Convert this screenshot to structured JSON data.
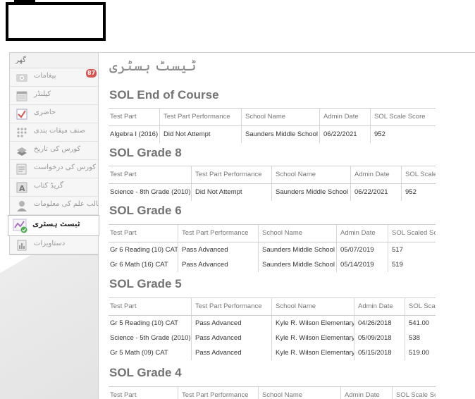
{
  "sidebar": {
    "home_label": "گھر",
    "items": [
      {
        "label": "پیغامات",
        "icon": "messages-icon",
        "badge": "87"
      },
      {
        "label": "کیلنڈر",
        "icon": "calendar-icon"
      },
      {
        "label": "حاضری",
        "icon": "attendance-icon"
      },
      {
        "label": "صنف میقات بندی",
        "icon": "class-schedule-icon"
      },
      {
        "label": "کورس کی تاریخ",
        "icon": "course-history-icon"
      },
      {
        "label": "کورس کی درخواست",
        "icon": "course-request-icon"
      },
      {
        "label": "گریڈ کتاب",
        "icon": "gradebook-icon"
      },
      {
        "label": "طالب علم کی معلومات",
        "icon": "student-info-icon"
      },
      {
        "label": "ٹیسٹ ہسٹری",
        "icon": "test-history-icon",
        "active": true
      },
      {
        "label": "دستاویزات",
        "icon": "documents-icon"
      }
    ]
  },
  "page_title": "ٹیسٹ ہسٹری",
  "sections": [
    {
      "title": "SOL End of Course",
      "headers": [
        "Test Part",
        "Test Part Performance",
        "School Name",
        "Admin Date",
        "SOL Scale Score"
      ],
      "rows": [
        [
          "Algebra I (2016)",
          "Did Not Attempt",
          "Saunders Middle School",
          "06/22/2021",
          "952"
        ]
      ]
    },
    {
      "title": "SOL Grade 8",
      "headers": [
        "Test Part",
        "Test Part Performance",
        "School Name",
        "Admin Date",
        "SOL Scale"
      ],
      "rows": [
        [
          "Science - 8th Grade (2010)",
          "Did Not Attempt",
          "Saunders Middle School",
          "06/22/2021",
          "952"
        ]
      ]
    },
    {
      "title": "SOL Grade 6",
      "headers": [
        "Test Part",
        "Test Part Performance",
        "School Name",
        "Admin Date",
        "SOL Scaled Sc"
      ],
      "rows": [
        [
          "Gr 6 Reading (10) CAT",
          "Pass Advanced",
          "Saunders Middle School",
          "05/07/2019",
          "517"
        ],
        [
          "Gr 6 Math (16) CAT",
          "Pass Advanced",
          "Saunders Middle School",
          "05/14/2019",
          "519"
        ]
      ]
    },
    {
      "title": "SOL Grade 5",
      "headers": [
        "Test Part",
        "Test Part Performance",
        "School Name",
        "Admin Date",
        "SOL Scal"
      ],
      "rows": [
        [
          "Gr 5 Reading (10) CAT",
          "Pass Advanced",
          "Kyle R. Wilson Elementary",
          "04/26/2018",
          "541.00"
        ],
        [
          "Science - 5th Grade (2010)",
          "Pass Advanced",
          "Kyle R. Wilson Elementary",
          "05/09/2018",
          "538"
        ],
        [
          "Gr 5 Math (09) CAT",
          "Pass Advanced",
          "Kyle R. Wilson Elementary",
          "05/15/2018",
          "519.00"
        ]
      ]
    },
    {
      "title": "SOL Grade 4",
      "headers": [
        "Test Part",
        "Test Part Performance",
        "School Name",
        "Admin Date",
        "SOL Scale Sc"
      ],
      "rows": []
    }
  ]
}
